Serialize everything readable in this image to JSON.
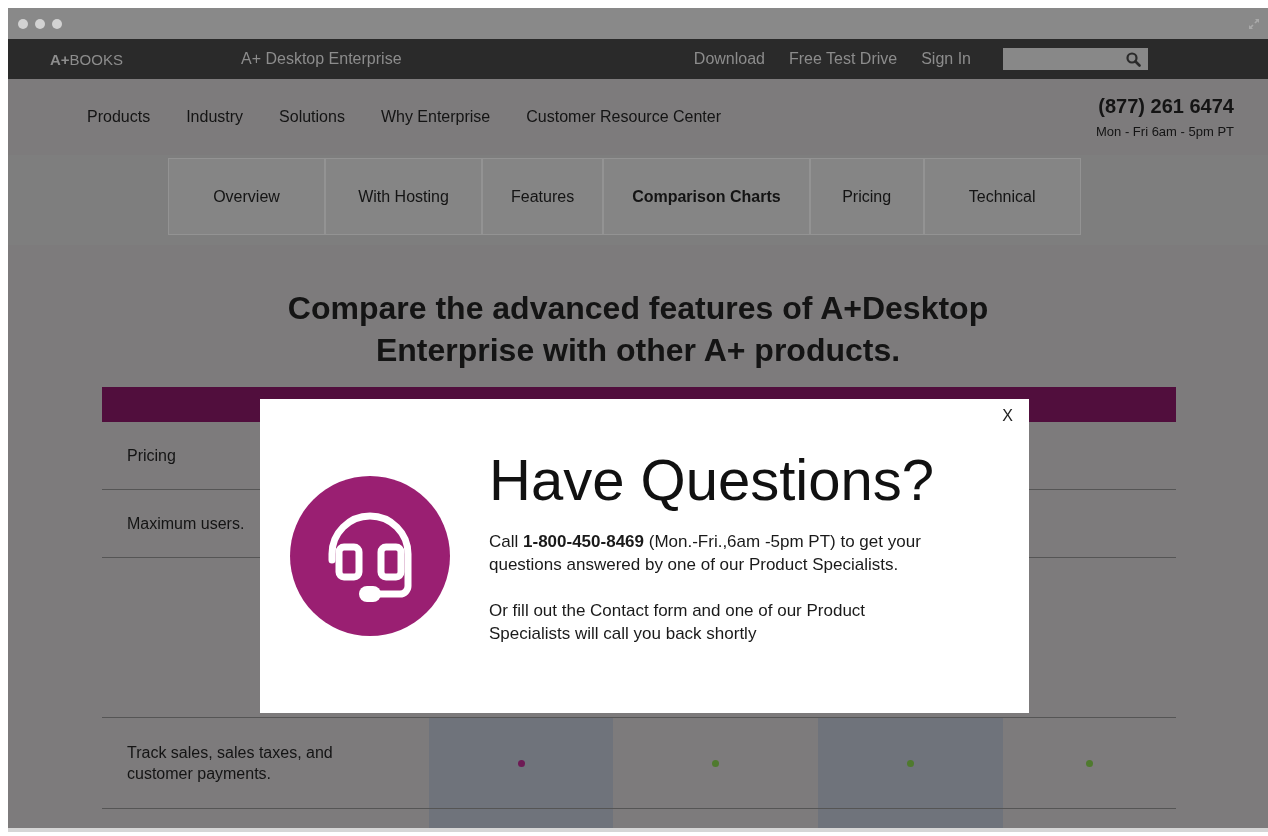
{
  "top_bar": {
    "logo": {
      "bold": "A+",
      "rest": "BOOKS"
    },
    "product": "A+ Desktop Enterprise",
    "links": [
      "Download",
      "Free Test Drive",
      "Sign In"
    ]
  },
  "main_nav": {
    "items": [
      "Products",
      "Industry",
      "Solutions",
      "Why Enterprise",
      "Customer Resource Center"
    ],
    "phone": "(877) 261 6474",
    "hours": "Mon - Fri 6am - 5pm PT"
  },
  "tabs": [
    {
      "label": "Overview",
      "selected": false
    },
    {
      "label": "With Hosting",
      "selected": false
    },
    {
      "label": "Features",
      "selected": false
    },
    {
      "label": "Comparison Charts",
      "selected": true
    },
    {
      "label": "Pricing",
      "selected": false
    },
    {
      "label": "Technical",
      "selected": false
    }
  ],
  "heading": "Compare the advanced features of A+Desktop Enterprise with other A+ products.",
  "table": {
    "columns": [
      {
        "shaded": true
      },
      {
        "shaded": false
      },
      {
        "shaded": true
      },
      {
        "shaded": false
      }
    ],
    "rows": [
      {
        "kind": "feature",
        "label": "Pricing"
      },
      {
        "kind": "feature",
        "label": "Maximum users."
      },
      {
        "kind": "spacer"
      },
      {
        "kind": "feature",
        "label": "Track sales, sales taxes, and customer payments.",
        "dots": [
          {
            "color": "#6e1a55"
          },
          {
            "color": "#4f7a2e"
          },
          {
            "color": "#4f7a2e"
          },
          {
            "color": "#4f7a2e"
          }
        ]
      }
    ]
  },
  "modal": {
    "close": "X",
    "title": "Have Questions?",
    "paragraphs": [
      "Call **1-800-450-8469** (Mon.-Fri.,6am -5pm PT) to get your questions answered by one of our Product Specialists.",
      "Or fill out the Contact form and one of our Product Specialists will call you back shortly"
    ]
  }
}
